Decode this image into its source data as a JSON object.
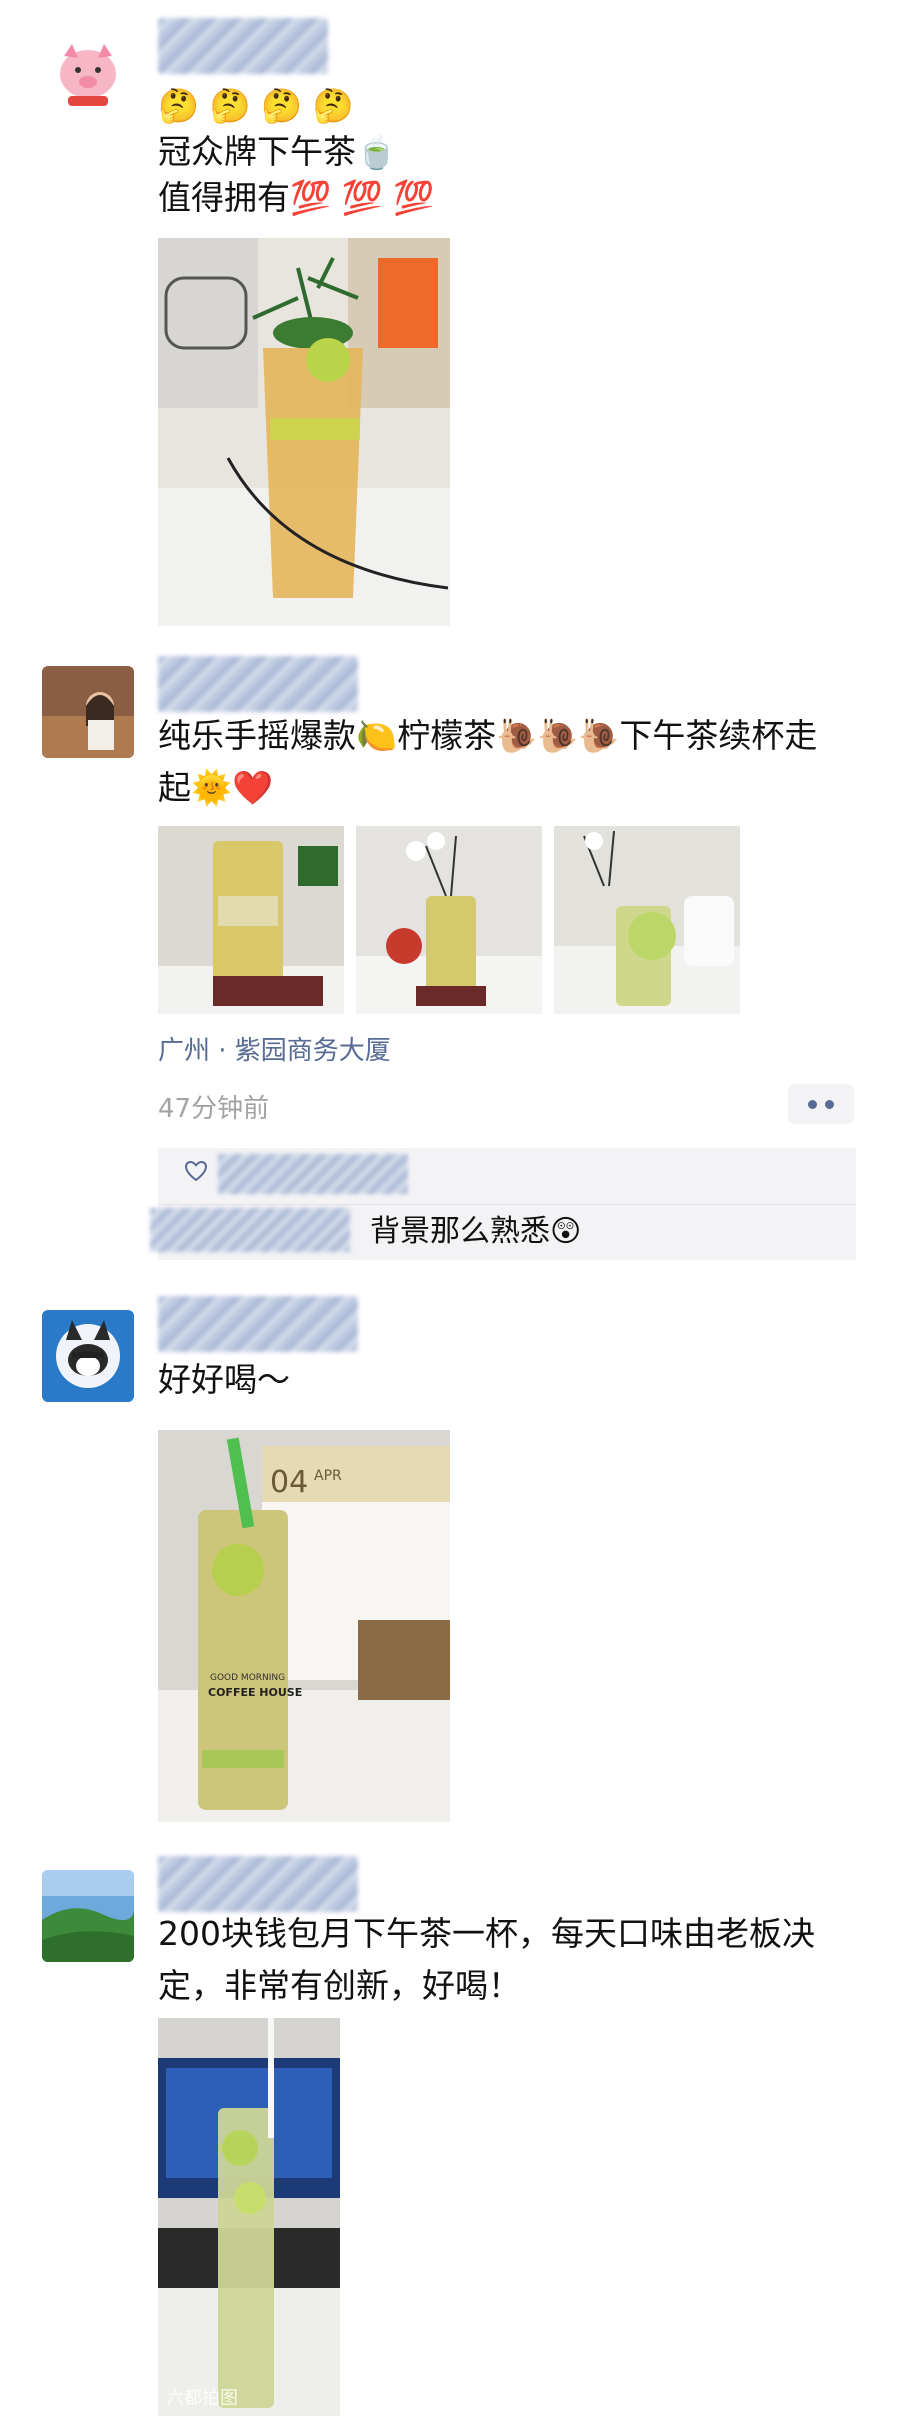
{
  "posts": [
    {
      "emojis": "🤔 🤔 🤔 🤔",
      "line1": "冠众牌下午茶🍵",
      "line2": "值得拥有💯 💯 💯"
    },
    {
      "text": "纯乐手摇爆款🍋柠檬茶🐌🐌🐌下午茶续杯走起🌞❤️",
      "location": "广州 · 紫园商务大厦",
      "time": "47分钟前",
      "comment_text": "背景那么熟悉😲"
    },
    {
      "text": "好好喝～",
      "cup_line1": "GOOD MORNING",
      "cup_line2": "COFFEE HOUSE",
      "calendar_day": "04",
      "calendar_month": "APR"
    },
    {
      "text": "200块钱包月下午茶一杯，每天口味由老板决定，非常有创新，好喝！"
    }
  ],
  "watermark": "六都拍图"
}
